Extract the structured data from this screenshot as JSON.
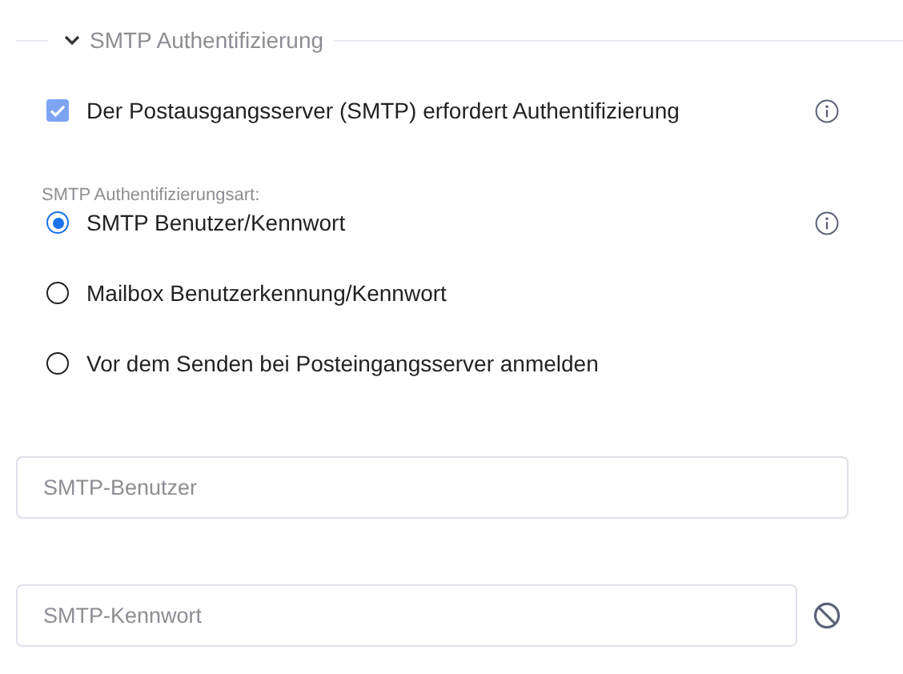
{
  "section": {
    "title": "SMTP Authentifizierung",
    "expanded": true
  },
  "require_auth": {
    "label": "Der Postausgangsserver (SMTP) erfordert Authentifizierung",
    "checked": true
  },
  "auth_type": {
    "label": "SMTP Authentifizierungsart:",
    "options": [
      {
        "label": "SMTP Benutzer/Kennwort",
        "selected": true,
        "info": true
      },
      {
        "label": "Mailbox Benutzerkennung/Kennwort",
        "selected": false,
        "info": false
      },
      {
        "label": "Vor dem Senden bei Posteingangsserver anmelden",
        "selected": false,
        "info": false
      }
    ]
  },
  "fields": [
    {
      "kind": "text",
      "placeholder": "SMTP-Benutzer"
    },
    {
      "kind": "password",
      "placeholder": "SMTP-Kennwort"
    }
  ]
}
